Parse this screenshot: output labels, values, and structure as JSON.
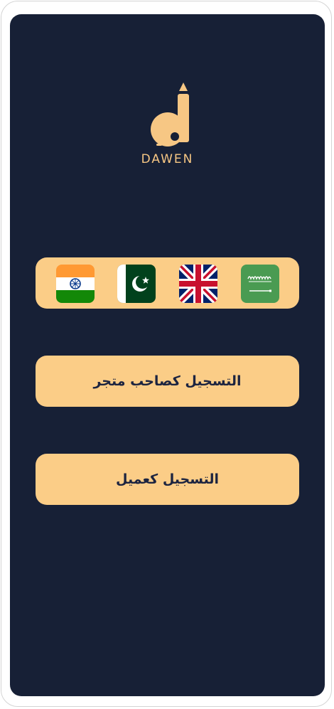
{
  "brand": {
    "name": "DAWEN",
    "logo_icon": "pencil-d-logo",
    "accent_color": "#fbcd87",
    "background_color": "#172036"
  },
  "languages": [
    {
      "name": "Arabic",
      "icon": "saudi-flag-icon"
    },
    {
      "name": "English",
      "icon": "uk-flag-icon"
    },
    {
      "name": "Urdu",
      "icon": "pakistan-flag-icon"
    },
    {
      "name": "Hindi",
      "icon": "india-flag-icon"
    }
  ],
  "actions": {
    "register_merchant": "التسجيل كصاحب متجر",
    "register_customer": "التسجيل كعميل"
  }
}
